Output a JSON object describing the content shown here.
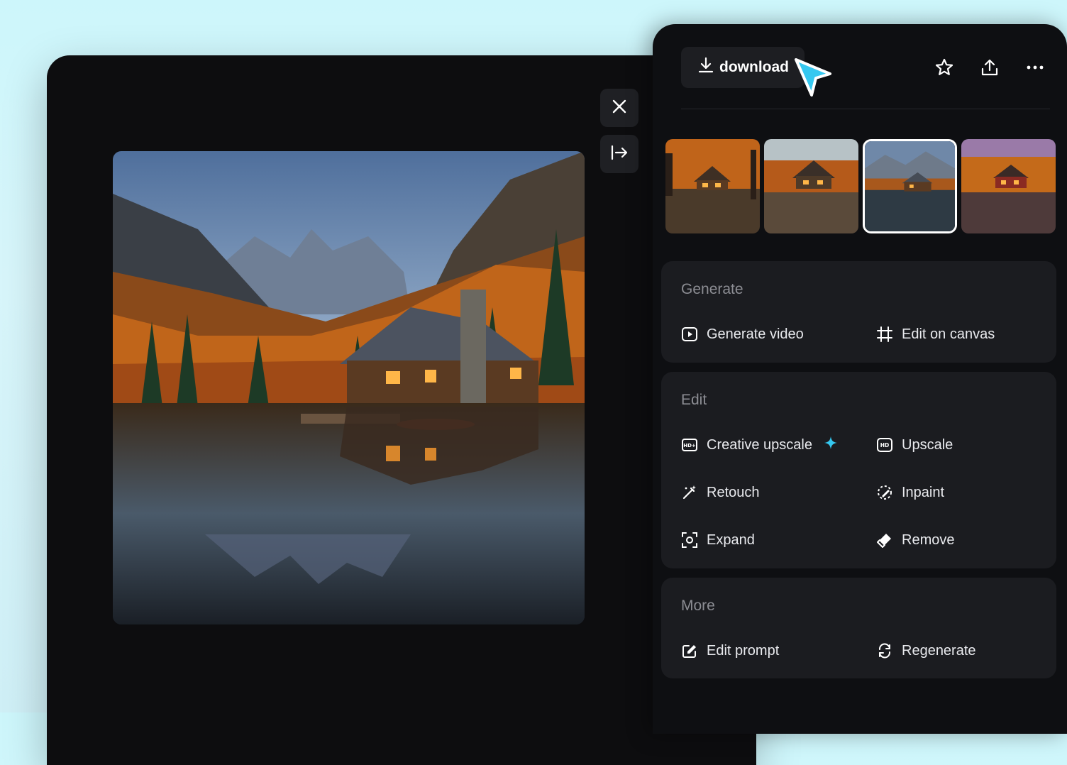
{
  "toolbar": {
    "download_label": "download",
    "icons": [
      "star-icon",
      "share-icon",
      "more-icon"
    ]
  },
  "viewer": {
    "close_icon": "close-icon",
    "collapse_icon": "collapse-panel-icon"
  },
  "thumbnails": [
    {
      "name": "variation-1",
      "selected": false
    },
    {
      "name": "variation-2",
      "selected": false
    },
    {
      "name": "variation-3",
      "selected": true
    },
    {
      "name": "variation-4",
      "selected": false
    }
  ],
  "sections": {
    "generate": {
      "title": "Generate",
      "items": [
        {
          "label": "Generate video",
          "icon": "play-video-icon"
        },
        {
          "label": "Edit on canvas",
          "icon": "crop-canvas-icon"
        }
      ]
    },
    "edit": {
      "title": "Edit",
      "items": [
        {
          "label": "Creative upscale",
          "icon": "hd-plus-icon"
        },
        {
          "label": "Upscale",
          "icon": "hd-icon"
        },
        {
          "label": "Retouch",
          "icon": "magic-wand-icon"
        },
        {
          "label": "Inpaint",
          "icon": "inpaint-icon"
        },
        {
          "label": "Expand",
          "icon": "expand-icon"
        },
        {
          "label": "Remove",
          "icon": "eraser-icon"
        }
      ]
    },
    "more": {
      "title": "More",
      "items": [
        {
          "label": "Edit prompt",
          "icon": "edit-prompt-icon"
        },
        {
          "label": "Regenerate",
          "icon": "regenerate-icon"
        }
      ]
    }
  },
  "colors": {
    "accent": "#35c8f0",
    "panel_bg": "#0e0f12",
    "card_bg": "#1b1c20",
    "page_bg": "#cdf6fb"
  }
}
